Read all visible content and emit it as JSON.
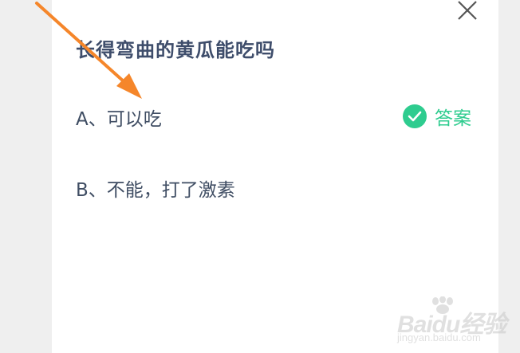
{
  "question": {
    "title": "长得弯曲的黄瓜能吃吗"
  },
  "options": [
    {
      "label": "A、可以吃"
    },
    {
      "label": "B、不能，打了激素"
    }
  ],
  "answer": {
    "label": "答案",
    "icon": "check-circle-icon",
    "color": "#2ecc8f"
  },
  "close": {
    "icon": "close-icon"
  },
  "annotation": {
    "icon": "arrow-icon",
    "color": "#f5862a"
  },
  "watermark": {
    "logo": "Baidu经验",
    "url": "jingyan.baidu.com"
  }
}
